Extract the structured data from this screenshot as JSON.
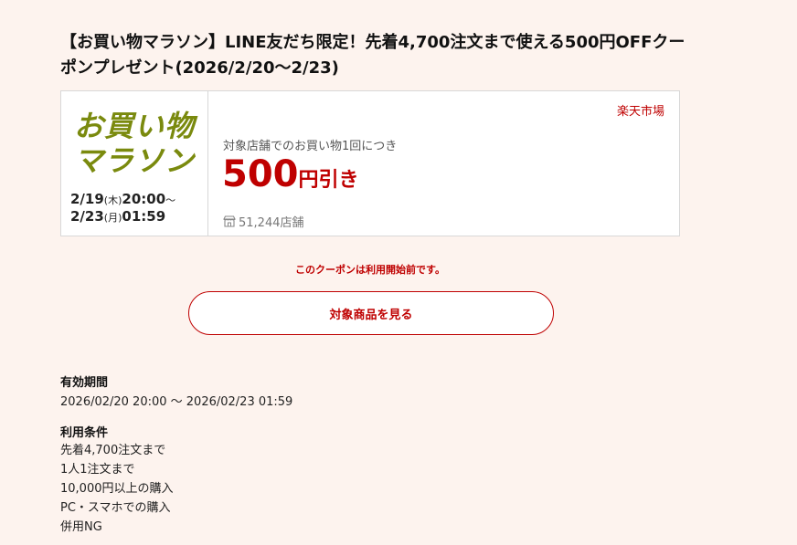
{
  "title": "【お買い物マラソン】LINE友だち限定！先着4,700注文まで使える500円OFFクーポンプレゼント(2026/2/20〜2/23)",
  "coupon": {
    "logo_line1": "お買い物",
    "logo_line2": "マラソン",
    "period_line1_date": "2/19",
    "period_line1_day": "(木)",
    "period_line1_time": "20:00",
    "period_line1_sep": "〜",
    "period_line2_date": "2/23",
    "period_line2_day": "(月)",
    "period_line2_time": "01:59",
    "shop_label": "楽天市場",
    "condition": "対象店舗でのお買い物1回につき",
    "discount_amount": "500",
    "discount_unit": "円引き",
    "store_count": "51,244店舗",
    "store_icon": "store-icon"
  },
  "notice": "このクーポンは利用開始前です。",
  "view_button_label": "対象商品を見る",
  "validity": {
    "label": "有効期間",
    "value": "2026/02/20 20:00 〜 2026/02/23 01:59"
  },
  "terms": {
    "label": "利用条件",
    "items": [
      "先着4,700注文まで",
      "1人1注文まで",
      "10,000円以上の購入",
      "PC・スマホでの購入",
      "併用NG"
    ]
  },
  "colors": {
    "background": "#fdf3ee",
    "accent_red": "#bf0000",
    "logo_green": "#7a8a0e"
  }
}
